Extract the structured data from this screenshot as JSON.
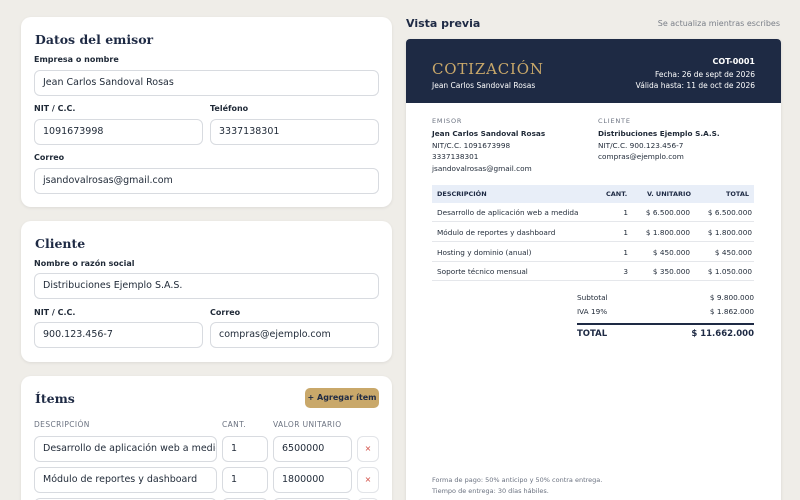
{
  "emisor_card": {
    "title": "Datos del emisor",
    "empresa_label": "Empresa o nombre",
    "empresa_value": "Jean Carlos Sandoval Rosas",
    "nit_label": "NIT / C.C.",
    "nit_value": "1091673998",
    "telefono_label": "Teléfono",
    "telefono_value": "3337138301",
    "correo_label": "Correo",
    "correo_value": "jsandovalrosas@gmail.com"
  },
  "cliente_card": {
    "title": "Cliente",
    "nombre_label": "Nombre o razón social",
    "nombre_value": "Distribuciones Ejemplo S.A.S.",
    "nit_label": "NIT / C.C.",
    "nit_value": "900.123.456-7",
    "correo_label": "Correo",
    "correo_value": "compras@ejemplo.com"
  },
  "items_card": {
    "title": "Ítems",
    "add_button": "+ Agregar ítem",
    "col_desc": "DESCRIPCIÓN",
    "col_cant": "CANT.",
    "col_valor": "VALOR UNITARIO",
    "remove_symbol": "×",
    "rows": [
      {
        "desc": "Desarrollo de aplicación web a medid",
        "cant": "1",
        "valor": "6500000"
      },
      {
        "desc": "Módulo de reportes y dashboard",
        "cant": "1",
        "valor": "1800000"
      }
    ]
  },
  "preview": {
    "title": "Vista previa",
    "note": "Se actualiza mientras escribes"
  },
  "doc": {
    "heading": "COTIZACIÓN",
    "issuer_name": "Jean Carlos Sandoval Rosas",
    "number": "COT-0001",
    "fecha": "Fecha: 26 de sept de 2026",
    "valida": "Válida hasta: 11 de oct de 2026",
    "emisor_label": "EMISOR",
    "emisor_name": "Jean Carlos Sandoval Rosas",
    "emisor_nit": "NIT/C.C. 1091673998",
    "emisor_tel": "3337138301",
    "emisor_email": "jsandovalrosas@gmail.com",
    "cliente_label": "CLIENTE",
    "cliente_name": "Distribuciones Ejemplo S.A.S.",
    "cliente_nit": "NIT/C.C. 900.123.456-7",
    "cliente_email": "compras@ejemplo.com",
    "th_desc": "DESCRIPCIÓN",
    "th_cant": "CANT.",
    "th_unit": "V. UNITARIO",
    "th_total": "TOTAL",
    "rows": [
      {
        "desc": "Desarrollo de aplicación web a medida",
        "cant": "1",
        "unit": "$ 6.500.000",
        "total": "$ 6.500.000"
      },
      {
        "desc": "Módulo de reportes y dashboard",
        "cant": "1",
        "unit": "$ 1.800.000",
        "total": "$ 1.800.000"
      },
      {
        "desc": "Hosting y dominio (anual)",
        "cant": "1",
        "unit": "$ 450.000",
        "total": "$ 450.000"
      },
      {
        "desc": "Soporte técnico mensual",
        "cant": "3",
        "unit": "$ 350.000",
        "total": "$ 1.050.000"
      }
    ],
    "subtotal_label": "Subtotal",
    "subtotal_value": "$ 9.800.000",
    "iva_label": "IVA 19%",
    "iva_value": "$ 1.862.000",
    "total_label": "TOTAL",
    "total_value": "$ 11.662.000",
    "footer_1": "Forma de pago: 50% anticipo y 50% contra entrega.",
    "footer_2": "Tiempo de entrega: 30 días hábiles."
  }
}
